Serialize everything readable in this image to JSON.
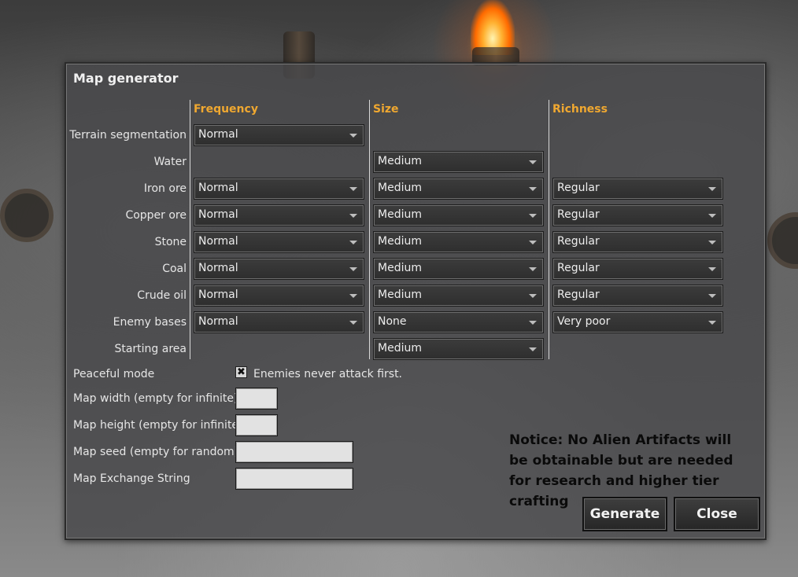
{
  "window": {
    "title": "Map generator"
  },
  "columns": {
    "frequency": "Frequency",
    "size": "Size",
    "richness": "Richness"
  },
  "rows": [
    {
      "label": "Terrain segmentation",
      "frequency": "Normal",
      "size": null,
      "richness": null
    },
    {
      "label": "Water",
      "frequency": null,
      "size": "Medium",
      "richness": null
    },
    {
      "label": "Iron ore",
      "frequency": "Normal",
      "size": "Medium",
      "richness": "Regular"
    },
    {
      "label": "Copper ore",
      "frequency": "Normal",
      "size": "Medium",
      "richness": "Regular"
    },
    {
      "label": "Stone",
      "frequency": "Normal",
      "size": "Medium",
      "richness": "Regular"
    },
    {
      "label": "Coal",
      "frequency": "Normal",
      "size": "Medium",
      "richness": "Regular"
    },
    {
      "label": "Crude oil",
      "frequency": "Normal",
      "size": "Medium",
      "richness": "Regular"
    },
    {
      "label": "Enemy bases",
      "frequency": "Normal",
      "size": "None",
      "richness": "Very poor"
    },
    {
      "label": "Starting area",
      "frequency": null,
      "size": "Medium",
      "richness": null
    }
  ],
  "peaceful": {
    "label": "Peaceful mode",
    "checked": true,
    "mark": "✖",
    "text": "Enemies never attack first."
  },
  "fields": {
    "map_width": {
      "label": "Map width (empty for infinite):",
      "value": ""
    },
    "map_height": {
      "label": "Map height (empty for infinite):",
      "value": ""
    },
    "map_seed": {
      "label": "Map seed (empty for random):",
      "value": ""
    },
    "exchange": {
      "label": "Map Exchange String",
      "value": ""
    }
  },
  "notice": "Notice: No Alien Artifacts will be obtainable but are needed for research and higher tier crafting",
  "buttons": {
    "generate": "Generate",
    "close": "Close"
  }
}
